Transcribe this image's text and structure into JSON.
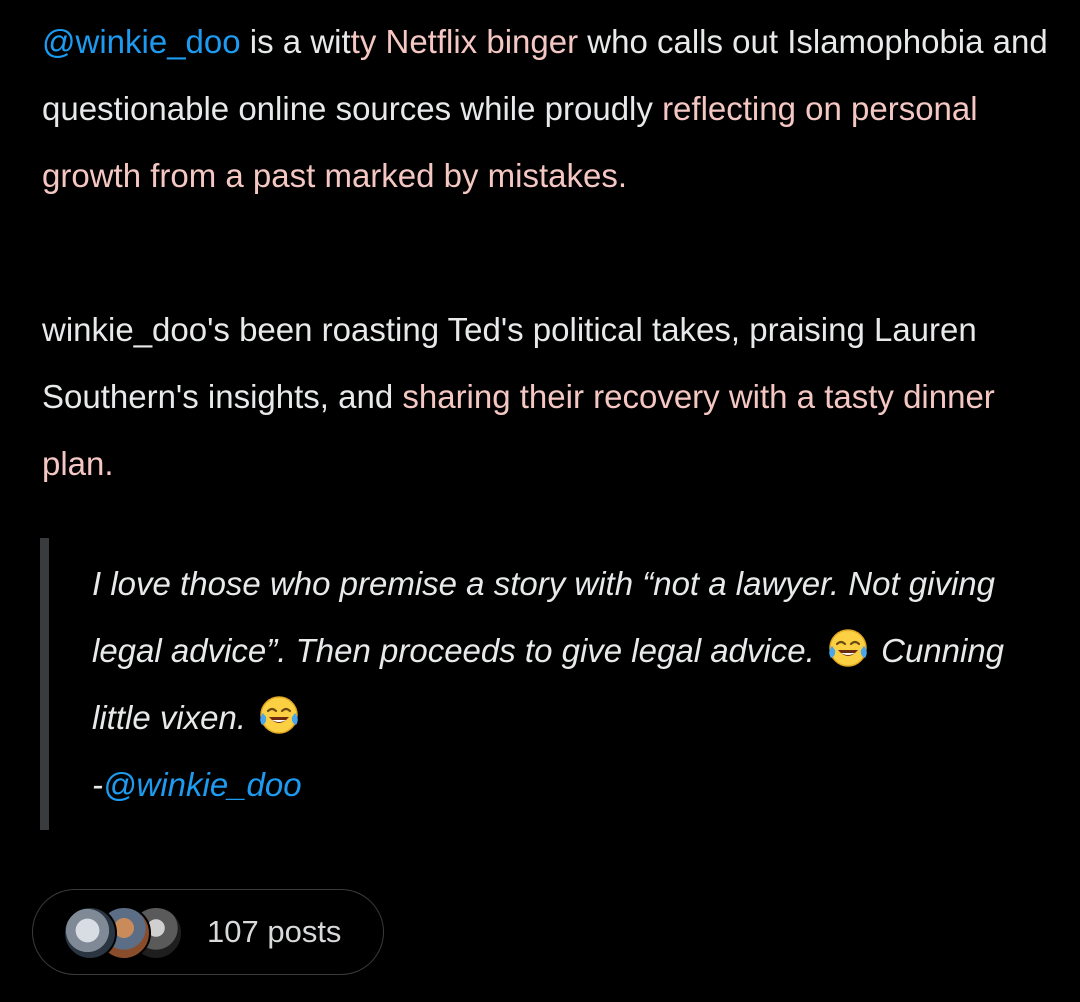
{
  "summary": {
    "mention": "@winkie_doo",
    "p1_a": " is a wit",
    "p1_hl1": "ty Netflix binger",
    "p1_b": " who calls out Islamophobia and questionable online sources while proudly ",
    "p1_hl2": "reflecting on personal growth from a past marked by mistakes.",
    "p2_a": "winkie_doo's been roasting Ted's political takes, praising Lauren Southern's insights, and ",
    "p2_hl": "sharing their recovery with a tasty dinner plan."
  },
  "quote": {
    "text_1": "I love those who premise a story with “not a lawyer. Not giving legal advice”. Then proceeds to give legal advice. ",
    "emoji_1": "face-with-tears-of-joy",
    "text_2": " Cunning little vixen. ",
    "emoji_2": "face-with-tears-of-joy",
    "attribution_prefix": "-",
    "attribution_mention": "@winkie_doo"
  },
  "posts_pill": {
    "label": "107 posts",
    "avatars": [
      "avatar-1",
      "avatar-2",
      "avatar-3"
    ]
  },
  "colors": {
    "background": "#000000",
    "text": "#e7e9ea",
    "mention": "#1d9bf0",
    "highlight": "#5a1414",
    "highlight_text": "#f4c7c3",
    "quote_bar": "#3a3b3d"
  }
}
